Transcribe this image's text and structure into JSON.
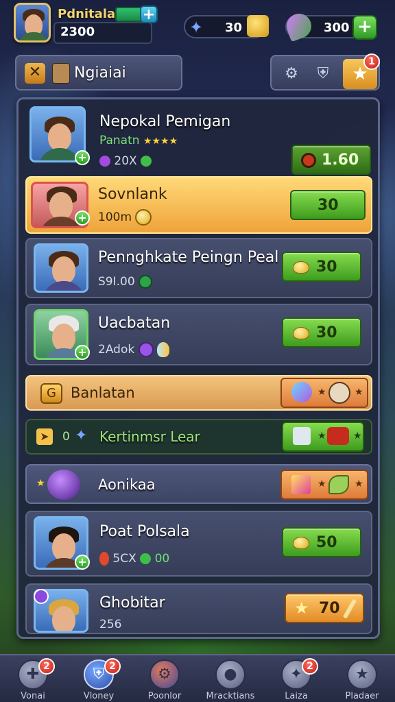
{
  "player": {
    "name": "Pdnitala",
    "coins": "2300"
  },
  "resources": [
    {
      "icon": "energy-bolt-icon",
      "value": "30"
    },
    {
      "icon": "leaf-gem-icon",
      "value": "300"
    }
  ],
  "header": {
    "tab_title": "Ngiaiai",
    "alert_badge": "1"
  },
  "cards": [
    {
      "name": "Nepokal Pemigan",
      "subtitle": "Panatn",
      "stat": "20X",
      "price": "1.60"
    },
    {
      "name": "Sovnlank",
      "subtitle": "100m",
      "price": "30"
    },
    {
      "name": "Pennghkate Peingn Peal",
      "subtitle": "S9I.00",
      "price": "30"
    },
    {
      "name": "Uacbatan",
      "subtitle": "2Adok",
      "price": "30"
    },
    {
      "name": "Banlatan"
    },
    {
      "label_prefix": "0",
      "name": "Kertinmsr Lear"
    },
    {
      "name": "Aonikaa"
    },
    {
      "name": "Poat Polsala",
      "stat_a": "5CX",
      "stat_b": "00",
      "price": "50"
    },
    {
      "name": "Ghobitar",
      "subtitle": "256",
      "price": "70"
    }
  ],
  "nav": [
    {
      "label": "Vonai",
      "badge": "2",
      "icon": "puzzle-icon"
    },
    {
      "label": "Vloney",
      "badge": "2",
      "icon": "shield-icon"
    },
    {
      "label": "Poonlor",
      "icon": "gear-medal-icon"
    },
    {
      "label": "Mracktians",
      "icon": "paw-icon"
    },
    {
      "label": "Laiza",
      "badge": "2",
      "icon": "shuriken-icon"
    },
    {
      "label": "Pladaer",
      "icon": "star-icon"
    }
  ]
}
